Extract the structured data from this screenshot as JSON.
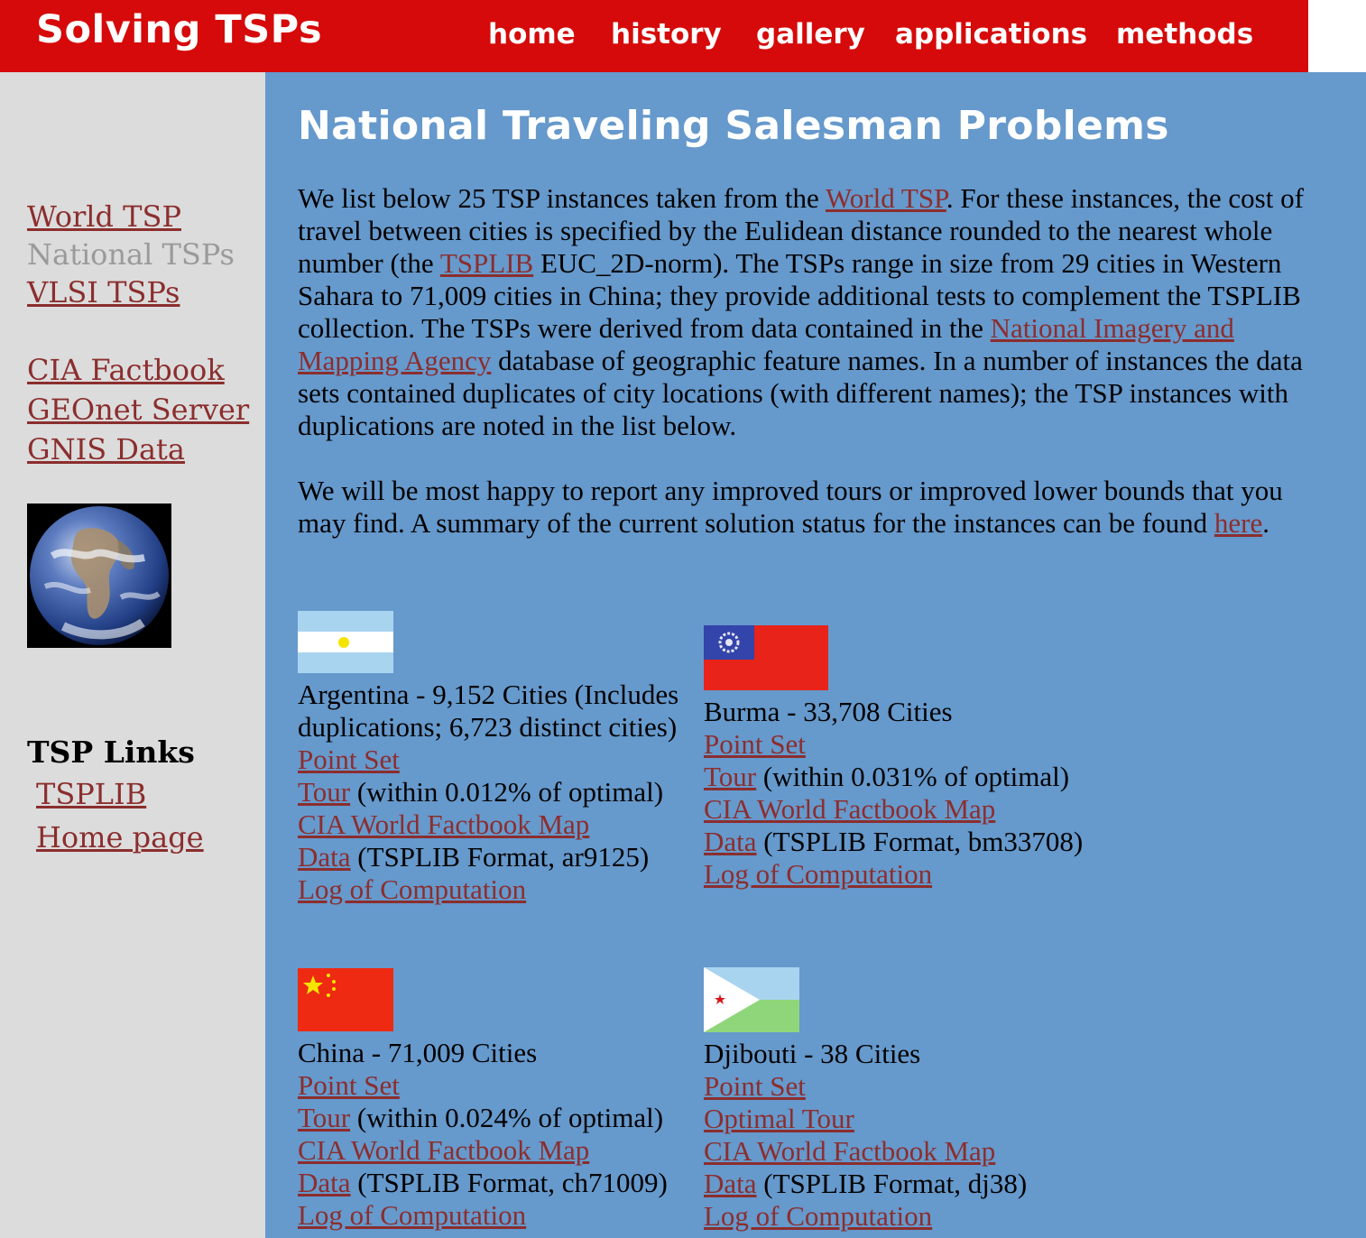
{
  "header": {
    "site_title": "Solving TSPs",
    "nav": [
      "home",
      "history",
      "gallery",
      "applications",
      "methods"
    ]
  },
  "sidebar": {
    "links_primary": [
      {
        "label": "World TSP",
        "current": false
      },
      {
        "label": "National TSPs",
        "current": true
      },
      {
        "label": "VLSI TSPs",
        "current": false
      }
    ],
    "links_secondary": [
      "CIA Factbook",
      "GEOnet Server",
      "GNIS Data"
    ],
    "image_icon": "earth-globe-icon",
    "tsp_links_heading": "TSP Links",
    "tsp_links": [
      "TSPLIB",
      "Home page"
    ]
  },
  "main": {
    "title": "National Traveling Salesman Problems",
    "intro": {
      "t1": "We list below 25 TSP instances taken from the ",
      "link1": "World TSP",
      "t2": ". For these instances, the cost of travel between cities is specified by the Eulidean distance rounded to the nearest whole number (the ",
      "link2": "TSPLIB",
      "t3": " EUC_2D-norm). The TSPs range in size from 29 cities in Western Sahara to 71,009 cities in China; they provide additional tests to complement the TSPLIB collection. The TSPs were derived from data contained in the ",
      "link3": "National Imagery and Mapping Agency",
      "t4": " database of geographic feature names. In a number of instances the data sets contained duplicates of city locations (with different names); the TSP instances with duplications are noted in the list below."
    },
    "status": {
      "t1": "We will be most happy to report any improved tours or improved lower bounds that you may find.  A summary of the current solution status for the instances can be found ",
      "link": "here",
      "t2": "."
    },
    "countries": [
      {
        "heading": "Argentina - 9,152 Cities (Includes duplications; 6,723 distinct cities)",
        "flag_icon": "argentina-flag-icon",
        "point_set": "Point Set",
        "tour_link": "Tour",
        "tour_note": " (within 0.012% of optimal)",
        "map": "CIA World Factbook Map",
        "data_link": "Data",
        "data_note": " (TSPLIB Format, ar9125)",
        "log": "Log of Computation"
      },
      {
        "heading": "Burma - 33,708 Cities",
        "flag_icon": "burma-flag-icon",
        "point_set": "Point Set",
        "tour_link": "Tour",
        "tour_note": " (within 0.031% of optimal)",
        "map": "CIA World Factbook Map",
        "data_link": "Data",
        "data_note": " (TSPLIB Format, bm33708)",
        "log": "Log of Computation"
      },
      {
        "heading": "China - 71,009 Cities",
        "flag_icon": "china-flag-icon",
        "point_set": "Point Set",
        "tour_link": "Tour",
        "tour_note": " (within 0.024% of optimal)",
        "map": "CIA World Factbook Map",
        "data_link": "Data",
        "data_note": " (TSPLIB Format, ch71009)",
        "log": "Log of Computation"
      },
      {
        "heading": "Djibouti - 38 Cities",
        "flag_icon": "djibouti-flag-icon",
        "point_set": "Point Set",
        "tour_link": "Optimal Tour",
        "tour_note": "",
        "map": "CIA World Factbook Map",
        "data_link": "Data",
        "data_note": " (TSPLIB Format, dj38)",
        "log": "Log of Computation"
      }
    ]
  },
  "colors": {
    "header_red": "#d60a0a",
    "main_blue": "#6699cc",
    "sidebar_gray": "#dcdcdc",
    "link": "#8b2e2e",
    "current_link_gray": "#9a9a9a"
  }
}
